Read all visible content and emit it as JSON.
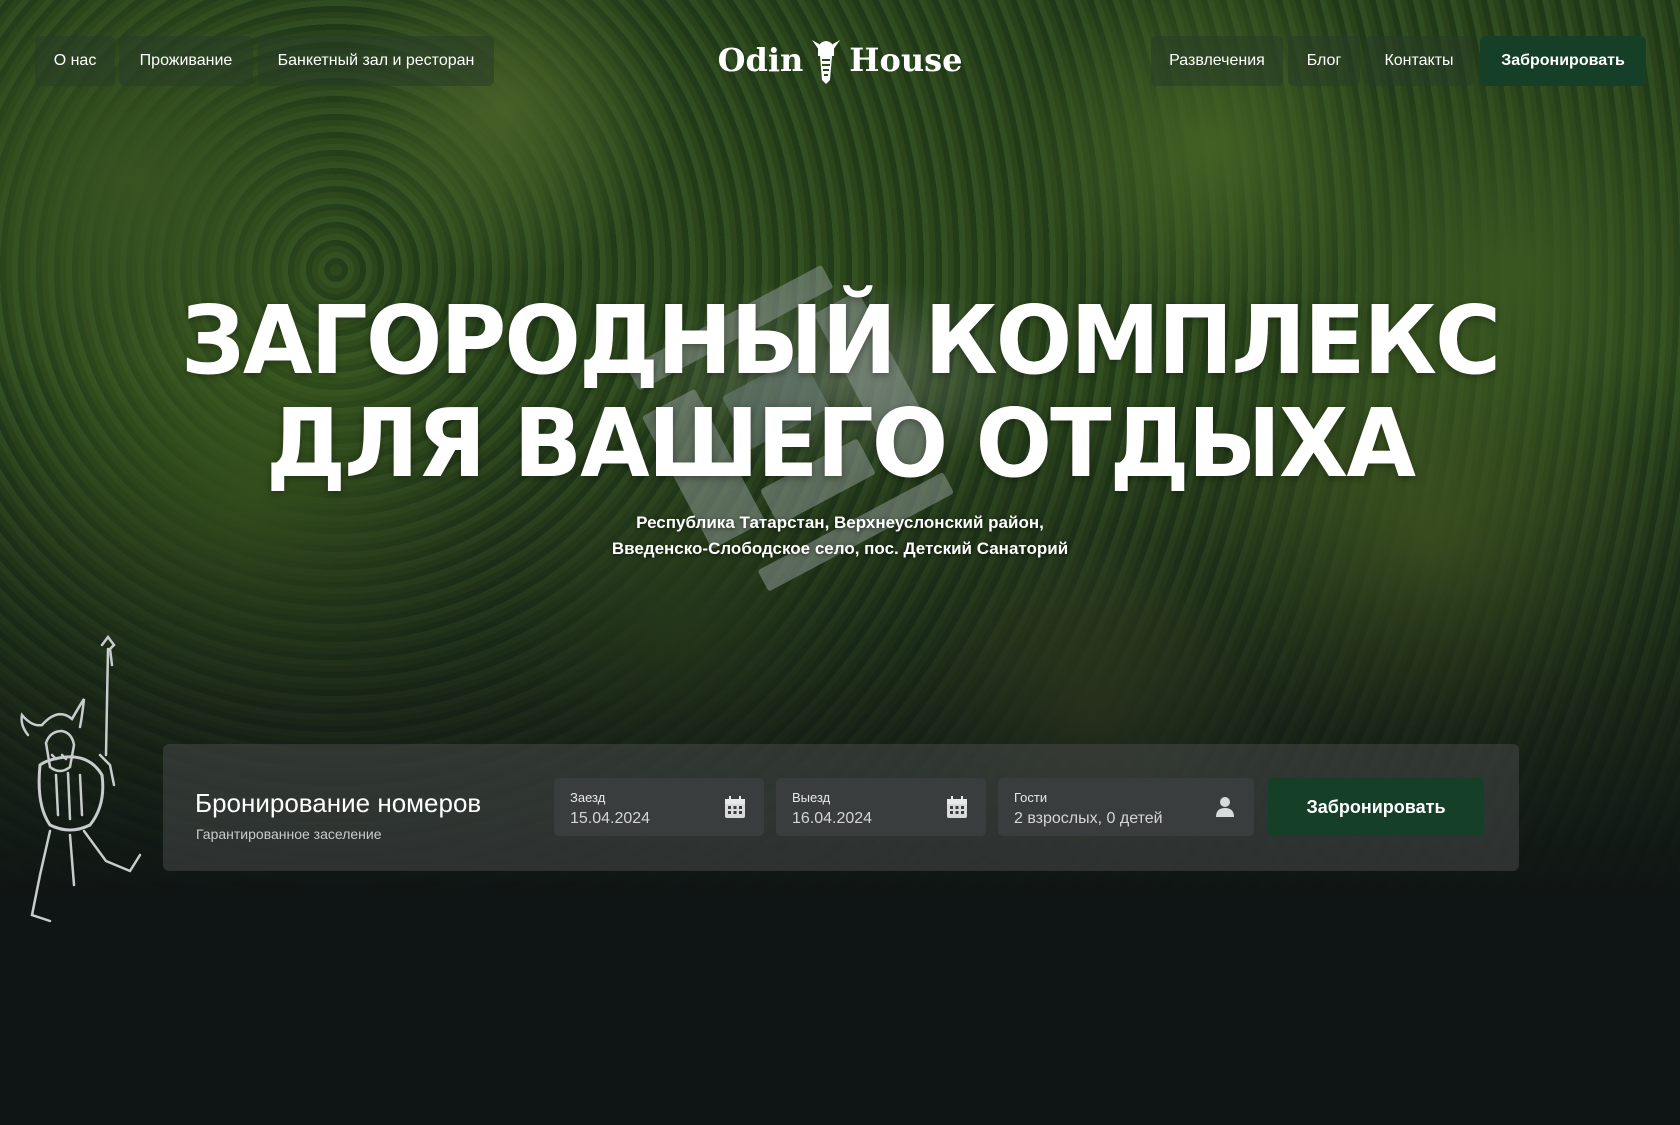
{
  "nav": {
    "left": [
      {
        "label": "О нас"
      },
      {
        "label": "Проживание"
      },
      {
        "label": "Банкетный зал и ресторан"
      }
    ],
    "right": [
      {
        "label": "Развлечения"
      },
      {
        "label": "Блог"
      },
      {
        "label": "Контакты"
      }
    ],
    "cta_label": "Забронировать"
  },
  "logo": {
    "word1": "Odin",
    "word2": "House"
  },
  "hero": {
    "title_line1": "ЗАГОРОДНЫЙ КОМПЛЕКС",
    "title_line2": "ДЛЯ ВАШЕГО ОТДЫХА",
    "address_line1": "Республика Татарстан, Верхнеуслонский район,",
    "address_line2": "Введенско-Слободское село, пос. Детский Санаторий"
  },
  "booking": {
    "title": "Бронирование номеров",
    "subtitle": "Гарантированное заселение",
    "checkin": {
      "label": "Заезд",
      "value": "15.04.2024",
      "icon": "calendar-icon"
    },
    "checkout": {
      "label": "Выезд",
      "value": "16.04.2024",
      "icon": "calendar-icon"
    },
    "guests": {
      "label": "Гости",
      "value": "2 взрослых, 0 детей",
      "icon": "user-icon"
    },
    "button_label": "Забронировать"
  },
  "colors": {
    "accent_green": "#163f28",
    "background": "#0f1414",
    "panel": "#464848"
  }
}
